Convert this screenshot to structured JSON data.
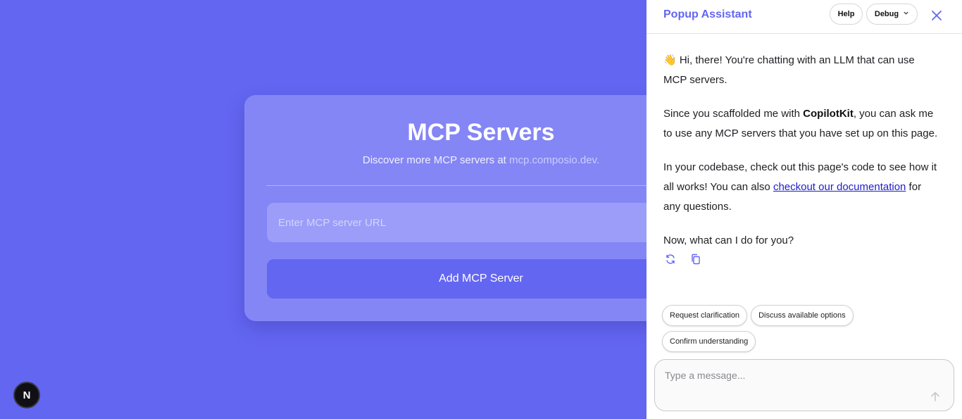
{
  "card": {
    "title": "MCP Servers",
    "subtitle_prefix": "Discover more MCP servers at ",
    "subtitle_link": "mcp.composio.dev.",
    "input_placeholder": "Enter MCP server URL",
    "input_value": "",
    "add_button": "Add MCP Server"
  },
  "badge": {
    "label": "N",
    "icon": "nextjs-icon"
  },
  "chat": {
    "title": "Popup Assistant",
    "help_label": "Help",
    "debug_label": "Debug",
    "close_icon": "close-icon",
    "messages": {
      "p1": "👋 Hi, there! You're chatting with an LLM that can use MCP servers.",
      "p2_before": "Since you scaffolded me with ",
      "p2_bold": "CopilotKit",
      "p2_after": ", you can ask me to use any MCP servers that you have set up on this page.",
      "p3_before": "In your codebase, check out this page's code to see how it all works! You can also ",
      "p3_link": "checkout our documentation",
      "p3_after": " for any questions.",
      "p4": "Now, what can I do for you?"
    },
    "suggestions": [
      "Request clarification",
      "Discuss available options",
      "Confirm understanding"
    ],
    "composer_placeholder": "Type a message...",
    "composer_value": ""
  },
  "colors": {
    "background": "#6366f1",
    "card": "#8486f5",
    "accent": "#6366f1",
    "link": "#1d1dcc"
  }
}
